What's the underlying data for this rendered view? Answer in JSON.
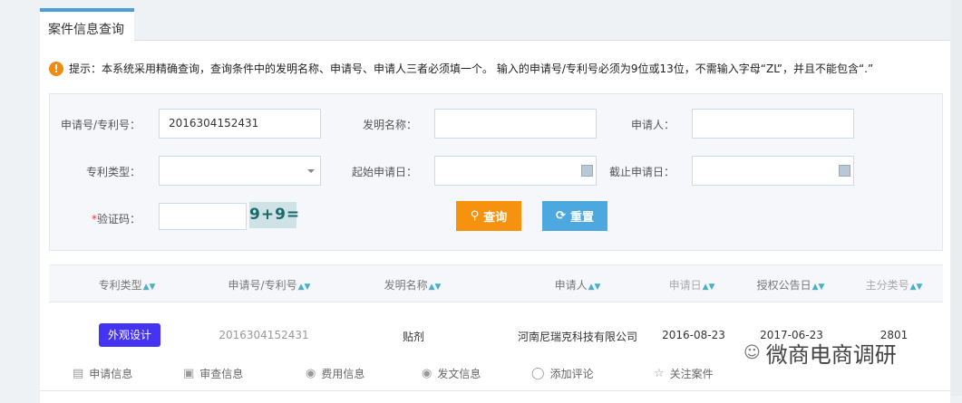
{
  "tab": {
    "label": "案件信息查询"
  },
  "notice": {
    "text": "提示：本系统采用精确查询，查询条件中的发明名称、申请号、申请人三者必须填一个。 输入的申请号/专利号必须为9位或13位，不需输入字母“ZL”，并且不能包含“.”"
  },
  "form": {
    "app_no_label": "申请号/专利号：",
    "app_no_value": "2016304152431",
    "title_label": "发明名称：",
    "title_value": "",
    "applicant_label": "申请人：",
    "applicant_value": "",
    "type_label": "专利类型：",
    "type_value": "",
    "start_label": "起始申请日：",
    "start_value": "",
    "end_label": "截止申请日：",
    "end_value": "",
    "captcha_required": "*",
    "captcha_label": "验证码：",
    "captcha_value": "",
    "captcha_image": "9+9=",
    "search_button": "查询",
    "reset_button": "重置"
  },
  "table": {
    "headers": [
      "专利类型",
      "申请号/专利号",
      "发明名称",
      "申请人",
      "申请日",
      "授权公告日",
      "主分类号"
    ],
    "rows": [
      {
        "type": "外观设计",
        "app_no": "2016304152431",
        "title": "贴剂",
        "applicant": "河南尼瑞克科技有限公司",
        "app_date": "2016-08-23",
        "grant_date": "2017-06-23",
        "class": "2801"
      }
    ],
    "actions": [
      "申请信息",
      "审查信息",
      "费用信息",
      "发文信息",
      "添加评论",
      "关注案件"
    ]
  },
  "watermark": "微商电商调研",
  "colors": {
    "accent": "#4a9fd8",
    "search": "#f7920f",
    "reset": "#4da8e0",
    "badge": "#4433f0"
  }
}
